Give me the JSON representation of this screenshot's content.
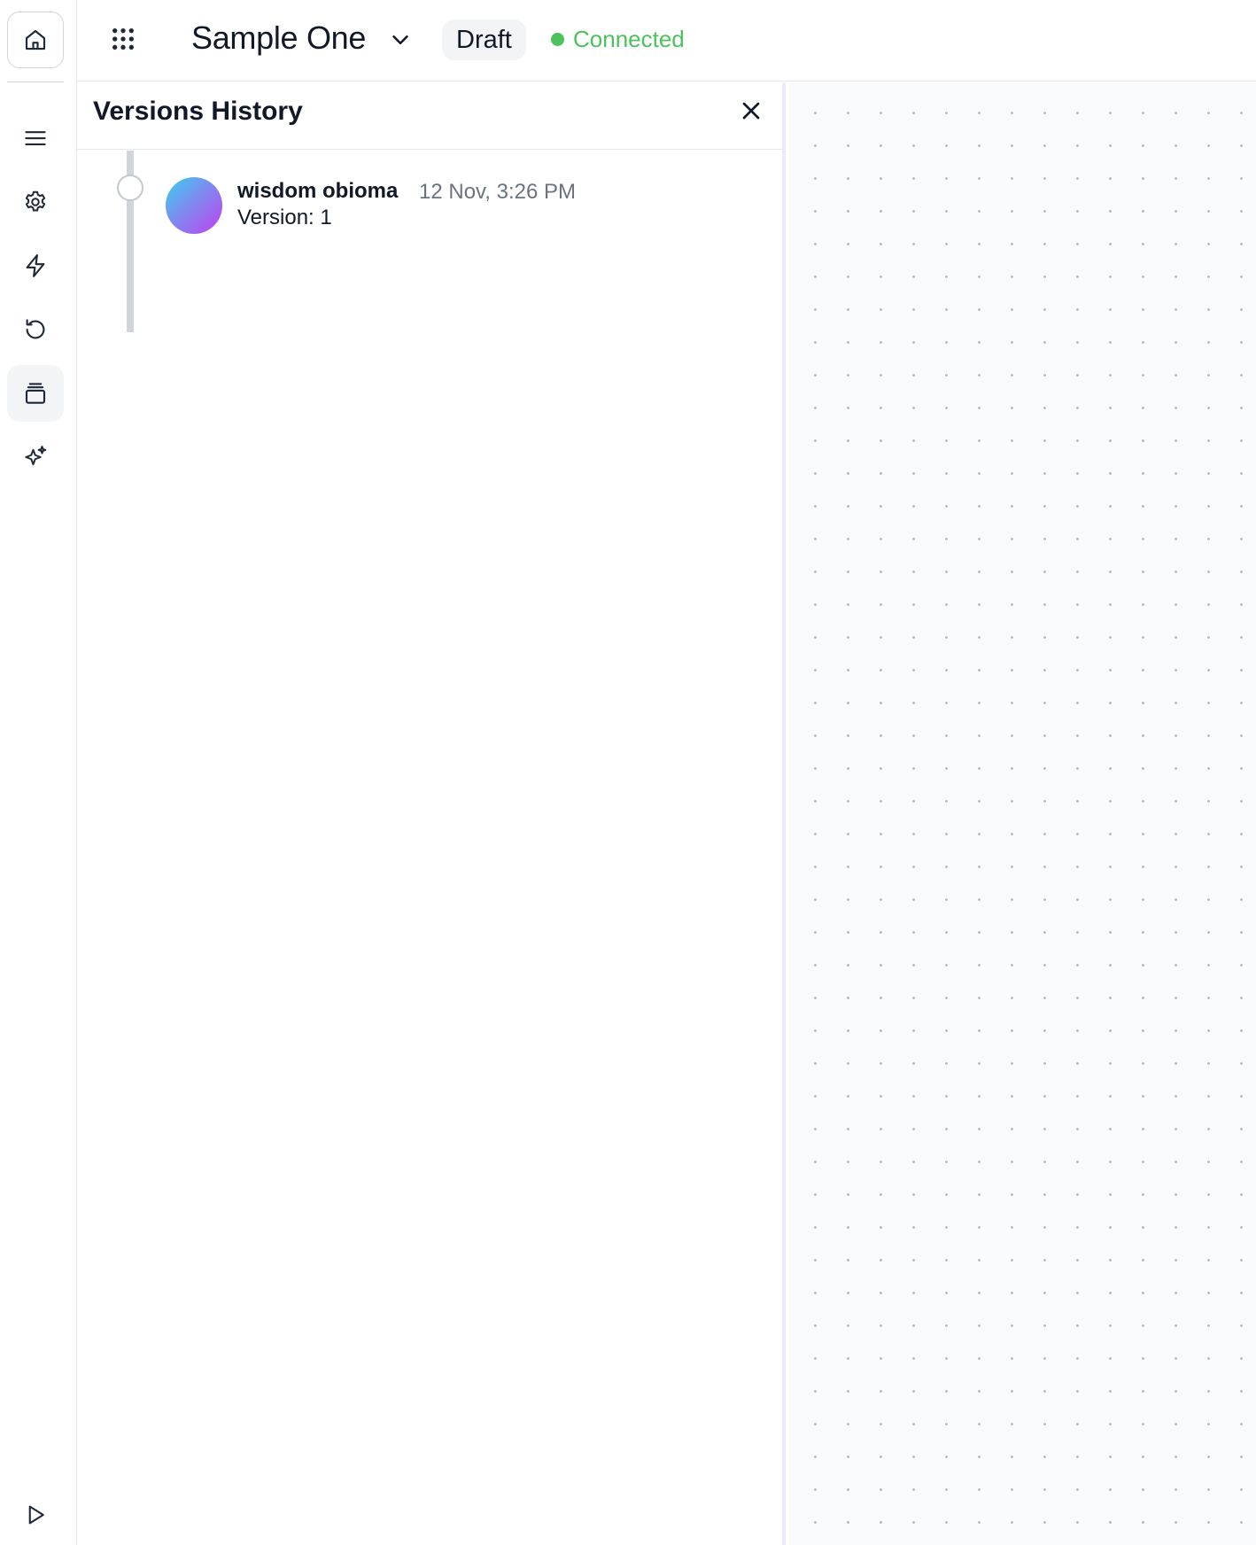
{
  "header": {
    "title": "Sample One",
    "badge": "Draft",
    "status": "Connected",
    "status_color": "#4cc25d"
  },
  "rail": {
    "items": [
      {
        "icon": "home-icon"
      },
      {
        "icon": "menu-icon"
      },
      {
        "icon": "gear-icon"
      },
      {
        "icon": "bolt-icon"
      },
      {
        "icon": "history-icon"
      },
      {
        "icon": "versions-icon",
        "active": true
      },
      {
        "icon": "sparkles-icon"
      },
      {
        "icon": "play-icon"
      }
    ]
  },
  "versions_panel": {
    "title": "Versions History",
    "entries": [
      {
        "author": "wisdom obioma",
        "timestamp": "12 Nov, 3:26 PM",
        "version": "Version: 1"
      }
    ]
  },
  "colors": {
    "accent_border": "#ede9fe",
    "canvas_bg": "#f9fafb"
  }
}
